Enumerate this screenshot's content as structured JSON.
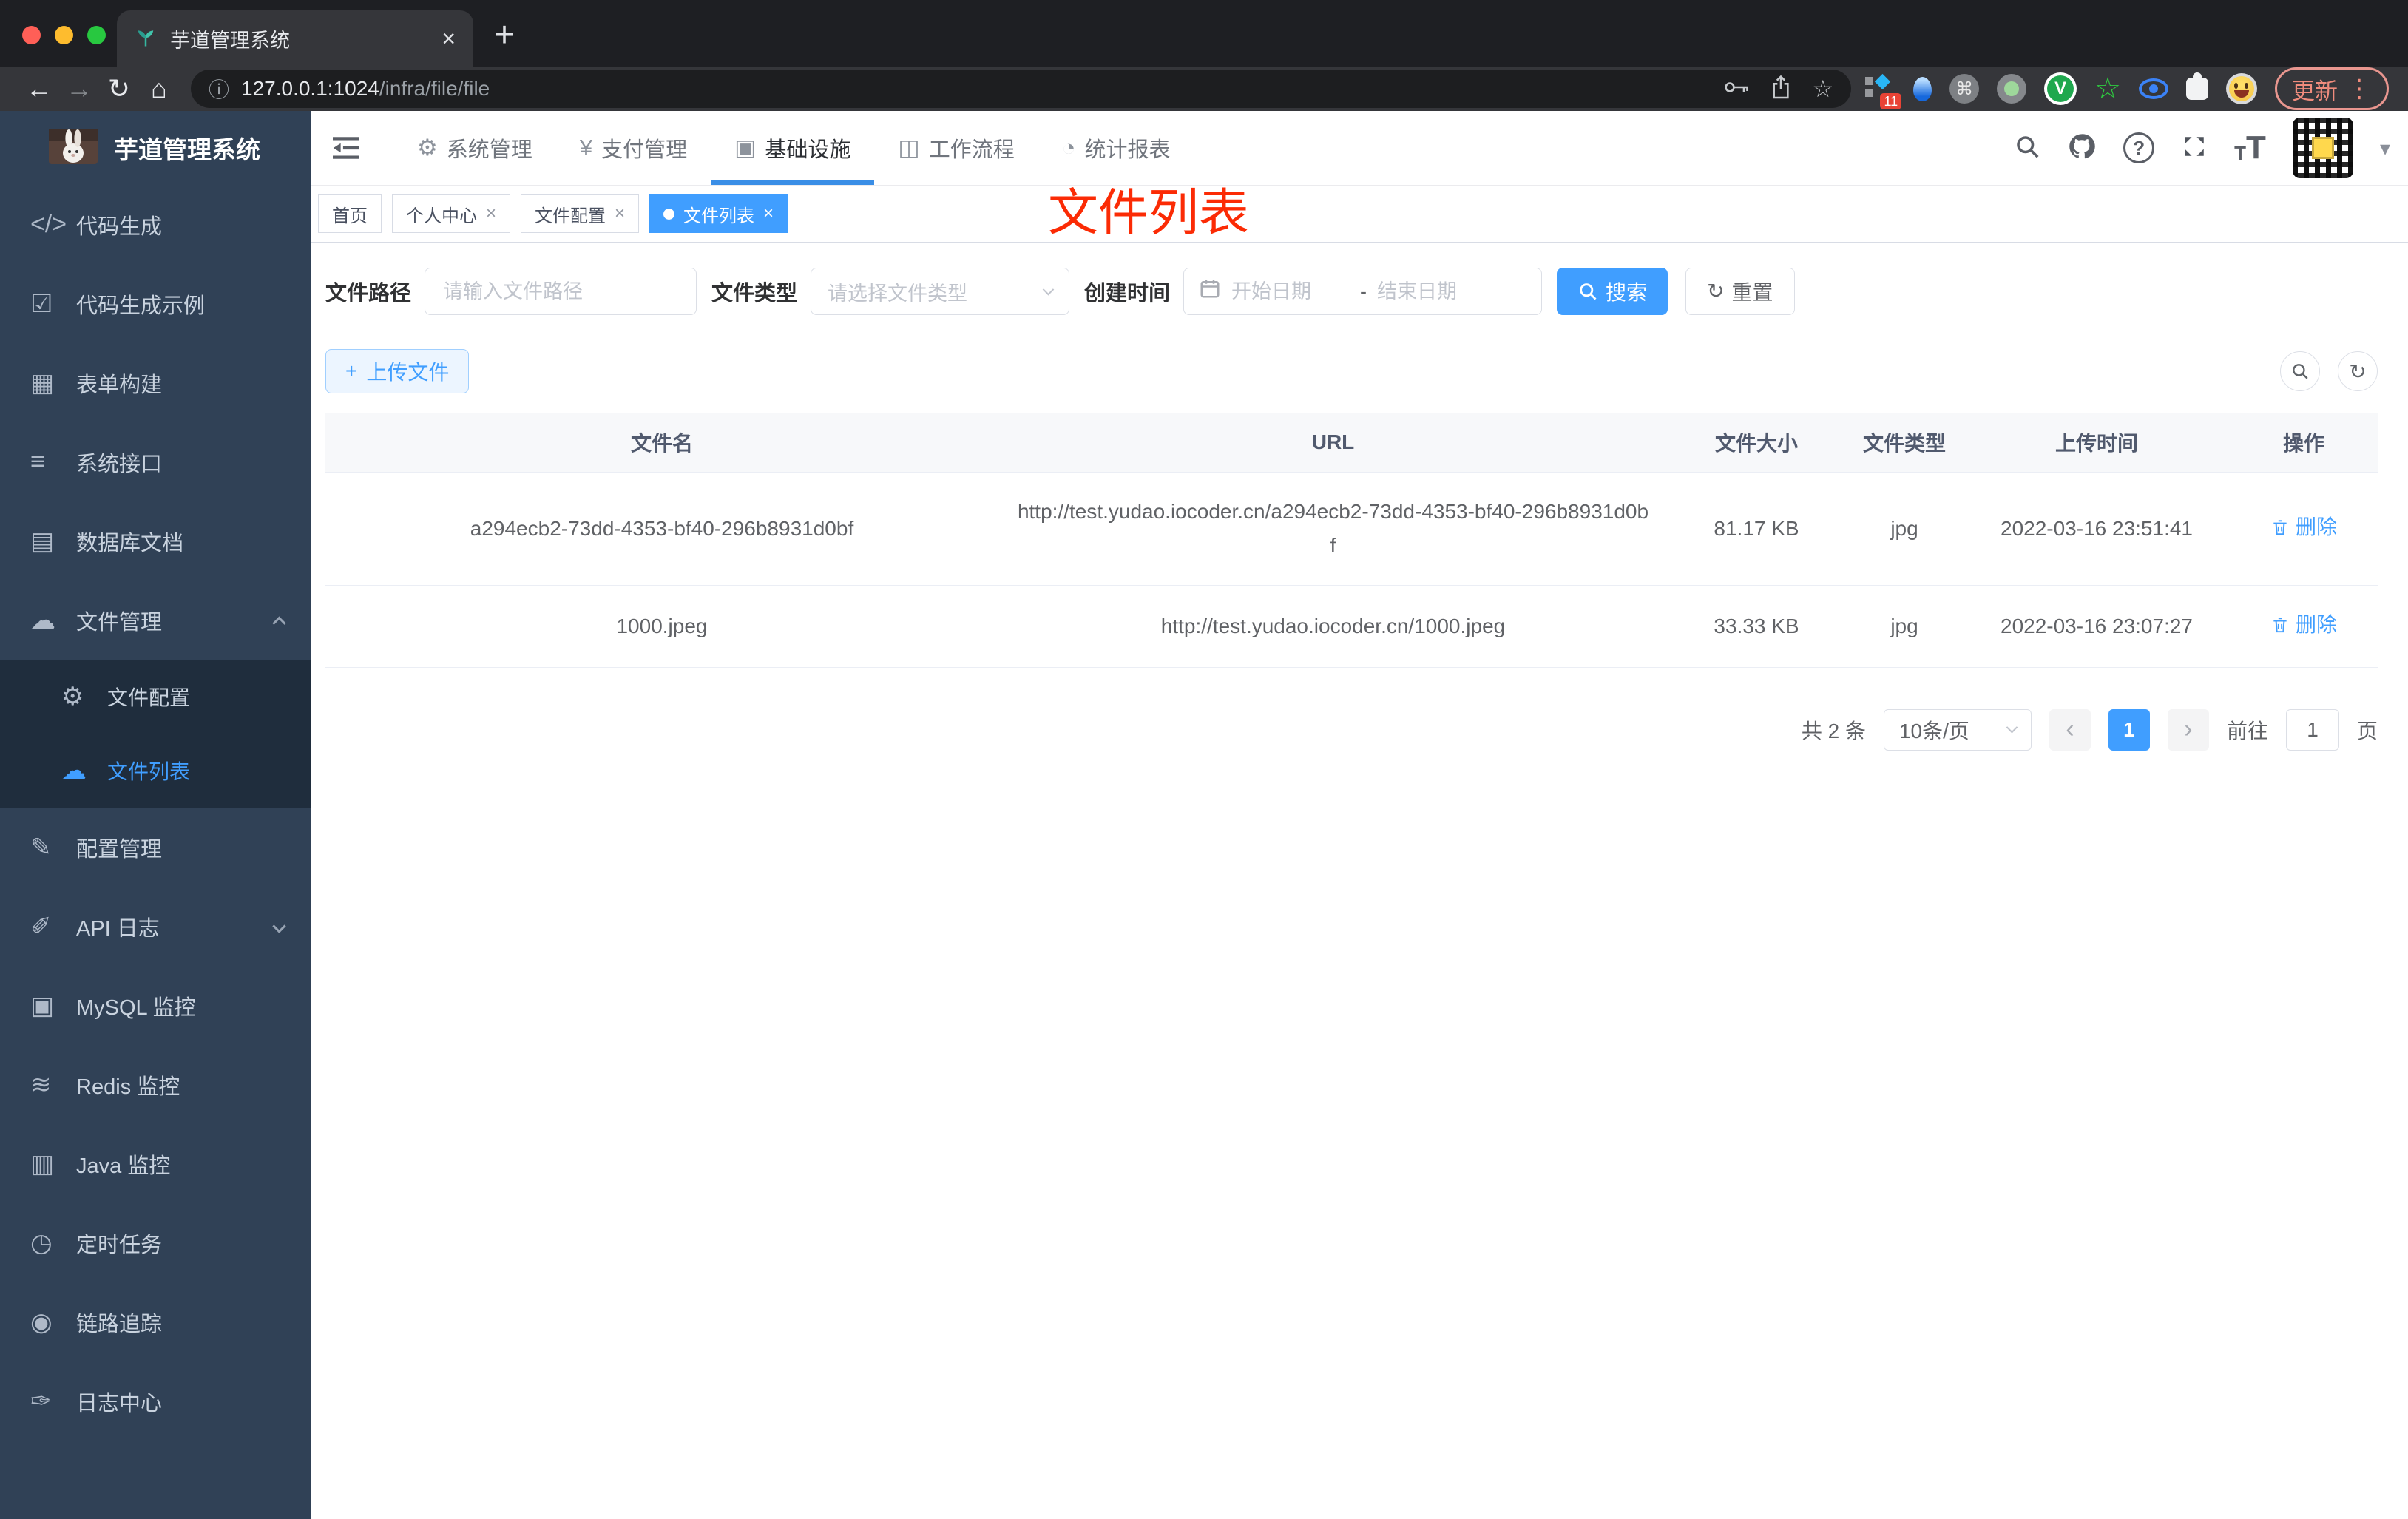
{
  "browser": {
    "tab_title": "芋道管理系统",
    "close_tab": "×",
    "new_tab": "+",
    "back": "←",
    "forward": "→",
    "reload": "↻",
    "home": "⌂",
    "info": "ⓘ",
    "url_host": "127.0.0.1:1024",
    "url_path": "/infra/file/file",
    "bookmark_star": "☆",
    "ext_badge": "11",
    "command_glyph": "⌘",
    "v_logo": "V",
    "star_wire": "☆",
    "update_label": "更新",
    "kebab": "⋮"
  },
  "sidebar": {
    "logo_title": "芋道管理系统",
    "items": [
      {
        "label": "代码生成"
      },
      {
        "label": "代码生成示例"
      },
      {
        "label": "表单构建"
      },
      {
        "label": "系统接口"
      },
      {
        "label": "数据库文档"
      },
      {
        "label": "文件管理"
      },
      {
        "label": "文件配置"
      },
      {
        "label": "文件列表"
      },
      {
        "label": "配置管理"
      },
      {
        "label": "API 日志"
      },
      {
        "label": "MySQL 监控"
      },
      {
        "label": "Redis 监控"
      },
      {
        "label": "Java 监控"
      },
      {
        "label": "定时任务"
      },
      {
        "label": "链路追踪"
      },
      {
        "label": "日志中心"
      }
    ]
  },
  "icons": {
    "code": "</>",
    "shield": "☑",
    "form": "▦",
    "sliders": "≡",
    "database": "▤",
    "cloud_down": "☁",
    "gear": "⚙",
    "cloud_up": "☁",
    "edit": "✎",
    "api_log": "✐",
    "mysql": "▣",
    "redis": "≋",
    "java": "▥",
    "timer": "◷",
    "eye": "◉",
    "log_center": "✑",
    "gear_nav": "⚙",
    "yen": "¥",
    "monitor_check": "▣",
    "briefcase": "◫",
    "dashboard": "◔",
    "plus": "+",
    "refresh": "↻",
    "caret_down": "▾"
  },
  "header": {
    "nav": [
      {
        "label": "系统管理"
      },
      {
        "label": "支付管理"
      },
      {
        "label": "基础设施"
      },
      {
        "label": "工作流程"
      },
      {
        "label": "统计报表"
      }
    ],
    "tt_small": "T",
    "tt_large": "T",
    "help_mark": "?"
  },
  "tags": [
    {
      "label": "首页"
    },
    {
      "label": "个人中心",
      "close": "×"
    },
    {
      "label": "文件配置",
      "close": "×"
    },
    {
      "label": "文件列表",
      "close": "×"
    }
  ],
  "annotation": {
    "text": "文件列表"
  },
  "filters": {
    "path_label": "文件路径",
    "path_placeholder": "请输入文件路径",
    "type_label": "文件类型",
    "type_placeholder": "请选择文件类型",
    "date_label": "创建时间",
    "date_start_placeholder": "开始日期",
    "date_separator": "-",
    "date_end_placeholder": "结束日期",
    "search_label": "搜索",
    "reset_label": "重置"
  },
  "toolbar": {
    "upload_label": "上传文件"
  },
  "table": {
    "headers": [
      "文件名",
      "URL",
      "文件大小",
      "文件类型",
      "上传时间",
      "操作"
    ],
    "rows": [
      {
        "name": "a294ecb2-73dd-4353-bf40-296b8931d0bf",
        "url": "http://test.yudao.iocoder.cn/a294ecb2-73dd-4353-bf40-296b8931d0bf",
        "size": "81.17 KB",
        "type": "jpg",
        "time": "2022-03-16 23:51:41",
        "action": "删除"
      },
      {
        "name": "1000.jpeg",
        "url": "http://test.yudao.iocoder.cn/1000.jpeg",
        "size": "33.33 KB",
        "type": "jpg",
        "time": "2022-03-16 23:07:27",
        "action": "删除"
      }
    ]
  },
  "pagination": {
    "total": "共 2 条",
    "page_size": "10条/页",
    "prev": "‹",
    "next": "›",
    "current": "1",
    "goto_label": "前往",
    "goto_value": "1",
    "page_label": "页"
  },
  "colors": {
    "accent": "#409eff",
    "annotation_red": "#fb2b05",
    "sidebar_bg": "#304156",
    "submenu_bg": "#1f2d3d",
    "nav_active_underline": "#3a8ee6",
    "header_dark": "#35363a"
  }
}
